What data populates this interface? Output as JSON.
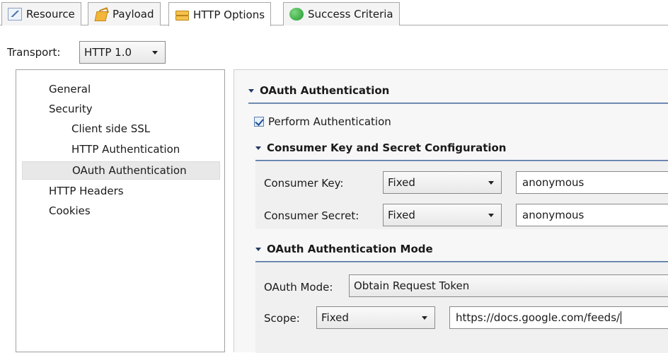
{
  "tabs": [
    {
      "label": "Resource",
      "icon": "resource-icon"
    },
    {
      "label": "Payload",
      "icon": "payload-icon"
    },
    {
      "label": "HTTP Options",
      "icon": "http-options-icon",
      "active": true
    },
    {
      "label": "Success Criteria",
      "icon": "success-criteria-icon"
    }
  ],
  "transport": {
    "label": "Transport:",
    "value": "HTTP 1.0"
  },
  "tree": {
    "items": [
      {
        "label": "General",
        "level": 0
      },
      {
        "label": "Security",
        "level": 0
      },
      {
        "label": "Client side SSL",
        "level": 1
      },
      {
        "label": "HTTP Authentication",
        "level": 1
      },
      {
        "label": "OAuth Authentication",
        "level": 1,
        "selected": true
      },
      {
        "label": "HTTP Headers",
        "level": 0
      },
      {
        "label": "Cookies",
        "level": 0
      }
    ]
  },
  "oauth": {
    "title": "OAuth Authentication",
    "perform_label": "Perform Authentication",
    "perform_checked": true,
    "consumer_section": {
      "title": "Consumer Key and Secret Configuration",
      "key_label": "Consumer Key:",
      "key_mode": "Fixed",
      "key_value": "anonymous",
      "secret_label": "Consumer Secret:",
      "secret_mode": "Fixed",
      "secret_value": "anonymous"
    },
    "mode_section": {
      "title": "OAuth Authentication Mode",
      "mode_label": "OAuth Mode:",
      "mode_value": "Obtain Request Token",
      "scope_label": "Scope:",
      "scope_mode": "Fixed",
      "scope_value": "https://docs.google.com/feeds/"
    }
  },
  "colors": {
    "section_rule": "#3d5e8e",
    "tab_border": "#a8a8a8",
    "selected_bg": "#e8e8e8"
  }
}
